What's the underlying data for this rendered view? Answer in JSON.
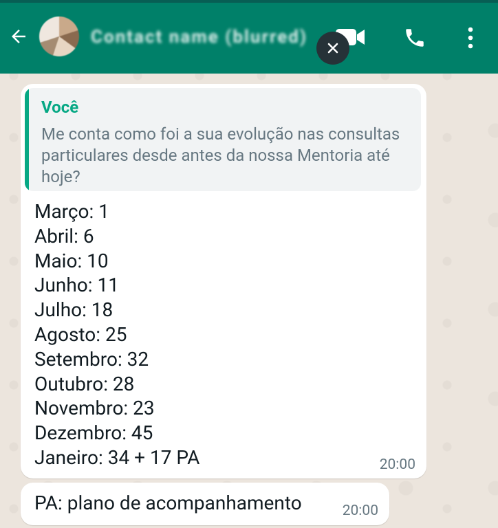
{
  "header": {
    "contact_name": "Contact name (blurred)",
    "colors": {
      "bar": "#008069",
      "accent": "#06a884"
    },
    "icons": [
      "back-arrow-icon",
      "avatar",
      "video-camera-icon",
      "phone-icon",
      "more-vertical-icon",
      "close-icon"
    ]
  },
  "chat": {
    "quote": {
      "author": "Você",
      "text": "Me conta como foi a sua evolução nas consultas particulares desde antes da nossa Mentoria até hoje?"
    },
    "message_lines": [
      "Março: 1",
      "Abril: 6",
      "Maio: 10",
      "Junho: 11",
      "Julho: 18",
      "Agosto: 25",
      "Setembro: 32",
      "Outubro: 28",
      "Novembro: 23",
      "Dezembro: 45",
      "Janeiro: 34 + 17 PA"
    ],
    "message_time": "20:00",
    "second_message": "PA: plano de acompanhamento",
    "second_time": "20:00"
  }
}
